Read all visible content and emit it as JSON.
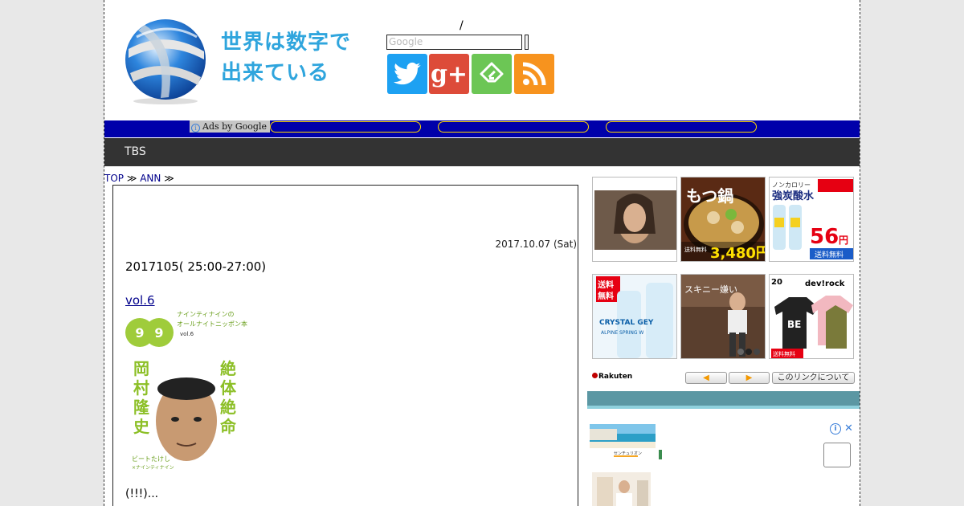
{
  "site": {
    "title_line1": "世界は数字で",
    "title_line2": "出来ている"
  },
  "search": {
    "slash": "/",
    "placeholder": "Google"
  },
  "social": {
    "gplus_label": "g+"
  },
  "adbar": {
    "ads_label": "Ads by Google",
    "info_icon": "i"
  },
  "nav": {
    "items": [
      "TBS"
    ]
  },
  "breadcrumb": {
    "top": "TOP",
    "sep1": " ≫ ",
    "ann": "ANN",
    "sep2": " ≫"
  },
  "article": {
    "date": "2017.10.07 (Sat)",
    "title": "2017105( 25:00-27:00)",
    "book_link": " vol.6 ",
    "snippet": "(!!!)..."
  },
  "book_cover": {
    "logo": "99",
    "header": "ナインティナインのオールナイトニッポン本",
    "vol": "vol.6",
    "name": "岡村隆史",
    "tagline": "絶体絶命",
    "footer": "ビートたけし×ナインティナイン"
  },
  "rakuten": {
    "products": [
      {
        "text": ""
      },
      {
        "text": "もつ鍋セット",
        "price": "3,480円"
      },
      {
        "text": "強炭酸水",
        "price": "56円"
      },
      {
        "text": "CRYSTAL GEYSER",
        "badge": "送料無料"
      },
      {
        "text": "スキニー嫌い"
      },
      {
        "text": "dev!rock",
        "badge": "送料無料"
      }
    ],
    "logo": "Rakuten",
    "prev_label": "◀",
    "next_label": "▶",
    "about_label": "このリンクについて"
  },
  "ad": {
    "choices_icon": "i",
    "close_icon": "✕",
    "thumb1_caption": "センチュリオン"
  },
  "colors": {
    "title": "#2fa5dd",
    "adbar": "#0000aa",
    "nav": "#333333",
    "sidebar_header": "#5b97a3"
  }
}
